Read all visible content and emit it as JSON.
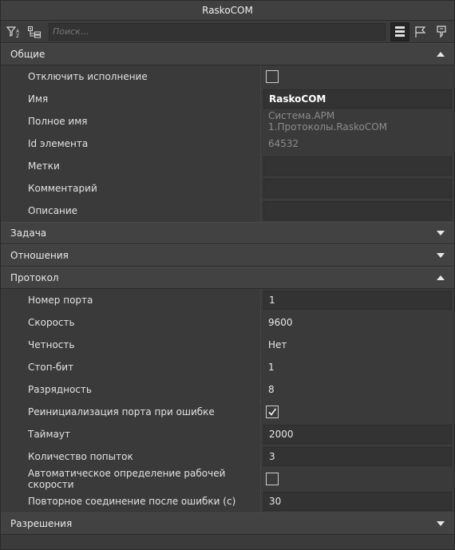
{
  "window": {
    "title": "RaskoCOM"
  },
  "toolbar": {
    "search_placeholder": "Поиск...",
    "icons": [
      "filter-icon",
      "tree-expand-icon",
      "list-view-icon",
      "flag-icon",
      "filter-flag-icon"
    ]
  },
  "sections": {
    "general": {
      "title": "Общие",
      "expanded": true,
      "rows": {
        "disable": {
          "label": "Отключить исполнение",
          "checked": false
        },
        "name": {
          "label": "Имя",
          "value": "RaskoCOM"
        },
        "fullname": {
          "label": "Полное имя",
          "value": "Система.АРМ 1.Протоколы.RaskoCOM"
        },
        "id": {
          "label": "Id элемента",
          "value": "64532"
        },
        "tags": {
          "label": "Метки",
          "value": ""
        },
        "comment": {
          "label": "Комментарий",
          "value": ""
        },
        "description": {
          "label": "Описание",
          "value": ""
        }
      }
    },
    "task": {
      "title": "Задача",
      "expanded": false
    },
    "relations": {
      "title": "Отношения",
      "expanded": false
    },
    "protocol": {
      "title": "Протокол",
      "expanded": true,
      "rows": {
        "port": {
          "label": "Номер порта",
          "value": "1"
        },
        "speed": {
          "label": "Скорость",
          "value": "9600"
        },
        "parity": {
          "label": "Четность",
          "value": "Нет"
        },
        "stopbit": {
          "label": "Стоп-бит",
          "value": "1"
        },
        "bits": {
          "label": "Разрядность",
          "value": "8"
        },
        "reinit": {
          "label": "Реинициализация порта при ошибке",
          "checked": true
        },
        "timeout": {
          "label": "Таймаут",
          "value": "2000"
        },
        "attempts": {
          "label": "Количество попыток",
          "value": "3"
        },
        "autospeed": {
          "label": "Автоматическое определение рабочей скорости",
          "checked": false
        },
        "reconnect": {
          "label": "Повторное соединение после ошибки (с)",
          "value": "30"
        }
      }
    },
    "permissions": {
      "title": "Разрешения",
      "expanded": false
    }
  },
  "colors": {
    "background": "#3b3b3b",
    "header": "#424242",
    "field": "#333333",
    "text": "#e6e6e6"
  }
}
